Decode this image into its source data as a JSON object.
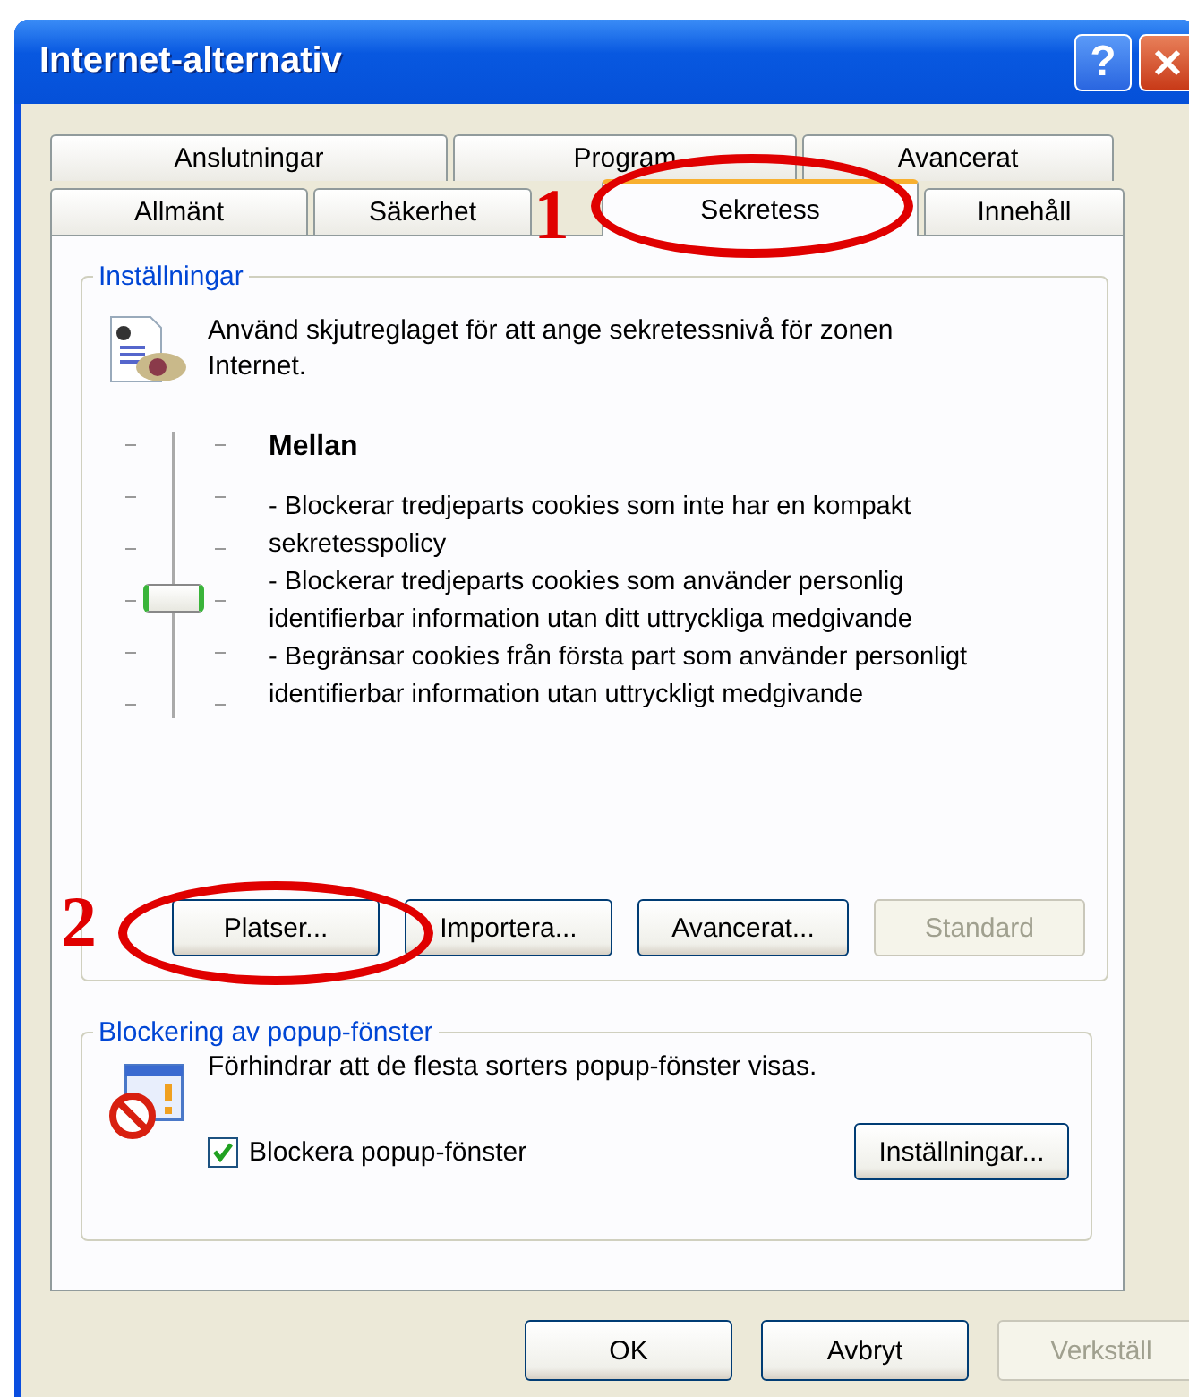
{
  "window": {
    "title": "Internet-alternativ",
    "help_label": "?"
  },
  "tab_rows": [
    [
      {
        "label": "Anslutningar",
        "selected": false
      },
      {
        "label": "Program",
        "selected": false
      },
      {
        "label": "Avancerat",
        "selected": false
      }
    ],
    [
      {
        "label": "Allmänt",
        "selected": false
      },
      {
        "label": "Säkerhet",
        "selected": false
      },
      {
        "label": "Sekretess",
        "selected": true
      },
      {
        "label": "Innehåll",
        "selected": false
      }
    ]
  ],
  "settings": {
    "title": "Inställningar",
    "intro": "Använd skjutreglaget för att ange sekretessnivå för zonen Internet.",
    "slider": {
      "level": 0.4
    },
    "level_name": "Mellan",
    "description": [
      "- Blockerar tredjeparts cookies som inte har en kompakt sekretesspolicy",
      "- Blockerar tredjeparts cookies som använder personlig identifierbar information utan ditt uttryckliga medgivande",
      "- Begränsar cookies från första part som använder personligt identifierbar information utan uttryckligt medgivande"
    ],
    "buttons": [
      {
        "label": "Platser...",
        "disabled": false
      },
      {
        "label": "Importera...",
        "disabled": false
      },
      {
        "label": "Avancerat...",
        "disabled": false
      },
      {
        "label": "Standard",
        "disabled": true
      }
    ]
  },
  "popup_blocking": {
    "title": "Blockering av popup-fönster",
    "text": "Förhindrar att de flesta sorters popup-fönster visas.",
    "checkbox": {
      "label": "Blockera popup-fönster",
      "checked": true
    },
    "button": {
      "label": "Inställningar...",
      "disabled": false
    }
  },
  "dialog_buttons": [
    {
      "label": "OK",
      "disabled": false
    },
    {
      "label": "Avbryt",
      "disabled": false
    },
    {
      "label": "Verkställ",
      "disabled": true
    }
  ],
  "annotations": [
    {
      "label": "1"
    },
    {
      "label": "2"
    }
  ]
}
